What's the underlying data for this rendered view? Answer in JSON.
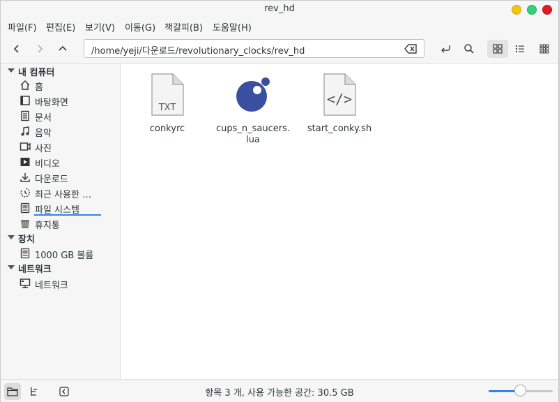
{
  "window": {
    "title": "rev_hd"
  },
  "menu": [
    "파일(F)",
    "편집(E)",
    "보기(V)",
    "이동(G)",
    "책갈피(B)",
    "도움말(H)"
  ],
  "pathbar": {
    "path": "/home/yeji/다운로드/revolutionary_clocks/rev_hd"
  },
  "sidebar": {
    "sections": [
      {
        "title": "내 컴퓨터",
        "items": [
          {
            "label": "홈",
            "icon": "home-icon"
          },
          {
            "label": "바탕화면",
            "icon": "desktop-icon"
          },
          {
            "label": "문서",
            "icon": "document-icon"
          },
          {
            "label": "음악",
            "icon": "music-icon"
          },
          {
            "label": "사진",
            "icon": "picture-icon"
          },
          {
            "label": "비디오",
            "icon": "video-icon"
          },
          {
            "label": "다운로드",
            "icon": "download-icon"
          },
          {
            "label": "최근 사용한 …",
            "icon": "recent-icon"
          },
          {
            "label": "파일 시스템",
            "icon": "drive-icon"
          },
          {
            "label": "휴지통",
            "icon": "trash-icon"
          }
        ]
      },
      {
        "title": "장치",
        "items": [
          {
            "label": "1000 GB 볼륨",
            "icon": "drive-icon"
          }
        ]
      },
      {
        "title": "네트워크",
        "items": [
          {
            "label": "네트워크",
            "icon": "network-icon"
          }
        ]
      }
    ]
  },
  "files": [
    {
      "name": "conkyrc",
      "type": "text",
      "badge": "TXT"
    },
    {
      "name": "cups_n_saucers.\nlua",
      "type": "lua"
    },
    {
      "name": "start_conky.sh",
      "type": "script",
      "badge": "</>"
    }
  ],
  "status": {
    "text": "항목 3 개, 사용 가능한 공간: 30.5 GB"
  },
  "zoom": {
    "level": 0.5
  },
  "colors": {
    "accent": "#3584e4",
    "lua": "#3a4fa0"
  }
}
